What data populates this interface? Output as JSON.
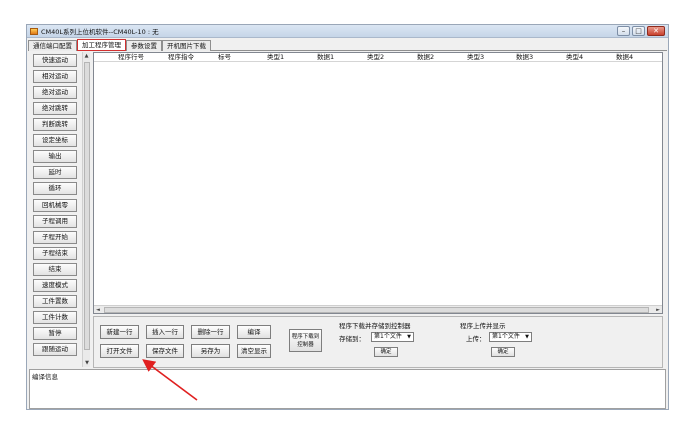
{
  "window": {
    "title": "CM40L系列上位机软件--CM40L-10 : 无",
    "minimize": "–",
    "maximize": "□",
    "close": "✕"
  },
  "tabs": [
    {
      "label": "通信端口配置"
    },
    {
      "label": "加工程序管理",
      "active": true
    },
    {
      "label": "参数设置"
    },
    {
      "label": "开机图片下载"
    }
  ],
  "command_buttons": [
    "快速运动",
    "相对运动",
    "绝对运动",
    "绝对跳转",
    "判断跳转",
    "设定坐标",
    "输出",
    "延时",
    "循环",
    "回机械零",
    "子程调用",
    "子程开始",
    "子程结束",
    "结束",
    "速度模式",
    "工件置数",
    "工件计数",
    "暂停",
    "跟随运动"
  ],
  "table": {
    "columns": [
      "程序行号",
      "程序指令",
      "标号",
      "类型1",
      "数据1",
      "类型2",
      "数据2",
      "类型3",
      "数据3",
      "类型4",
      "数据4"
    ]
  },
  "bottom": {
    "new_line": "新建一行",
    "insert_line": "插入一行",
    "delete_line": "删除一行",
    "compile": "编译",
    "open_file": "打开文件",
    "save_file": "保存文件",
    "save_as": "另存为",
    "clear_display": "清空显示",
    "download_button": "程序下载到控制器",
    "download_group_title": "程序下载并存储到控制器",
    "store_to_label": "存储到：",
    "store_to_value": "第1个文件",
    "confirm_download": "确定",
    "upload_group_title": "程序上传并显示",
    "upload_label": "上传：",
    "upload_value": "第1个文件",
    "confirm_upload": "确定"
  },
  "info": {
    "title": "编译信息"
  },
  "colors": {
    "active_tab_border": "#d23030",
    "annotation_arrow": "#e02020"
  }
}
